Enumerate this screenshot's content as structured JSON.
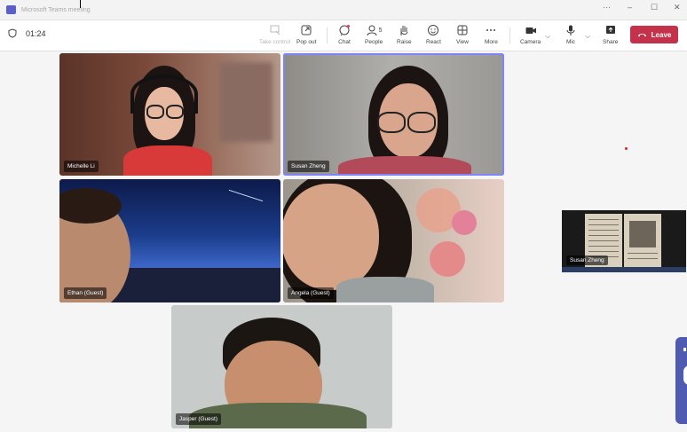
{
  "window": {
    "title": "Microsoft Teams meeting",
    "controls": [
      "···",
      "–",
      "☐",
      "✕"
    ]
  },
  "toolbar": {
    "timer": "01:24",
    "buttons": {
      "take_control": "Take control",
      "pop_out": "Pop out",
      "chat": "Chat",
      "people": "People",
      "people_count": "5",
      "raise": "Raise",
      "react": "React",
      "view": "View",
      "more": "More",
      "camera": "Camera",
      "mic": "Mic",
      "share": "Share"
    },
    "leave": "Leave",
    "colors": {
      "leave": "#c4314b",
      "accent": "#5b5fc7",
      "chat_badge": "#e3495a"
    }
  },
  "participants": [
    {
      "name": "Michelle Li"
    },
    {
      "name": "Susan Zheng",
      "active_speaker": true
    },
    {
      "name": "Ethan (Guest)"
    },
    {
      "name": "Angela (Guest)"
    },
    {
      "name": "Jasper (Guest)"
    }
  ],
  "shared_screen": {
    "presenter": "Susan Zheng"
  }
}
